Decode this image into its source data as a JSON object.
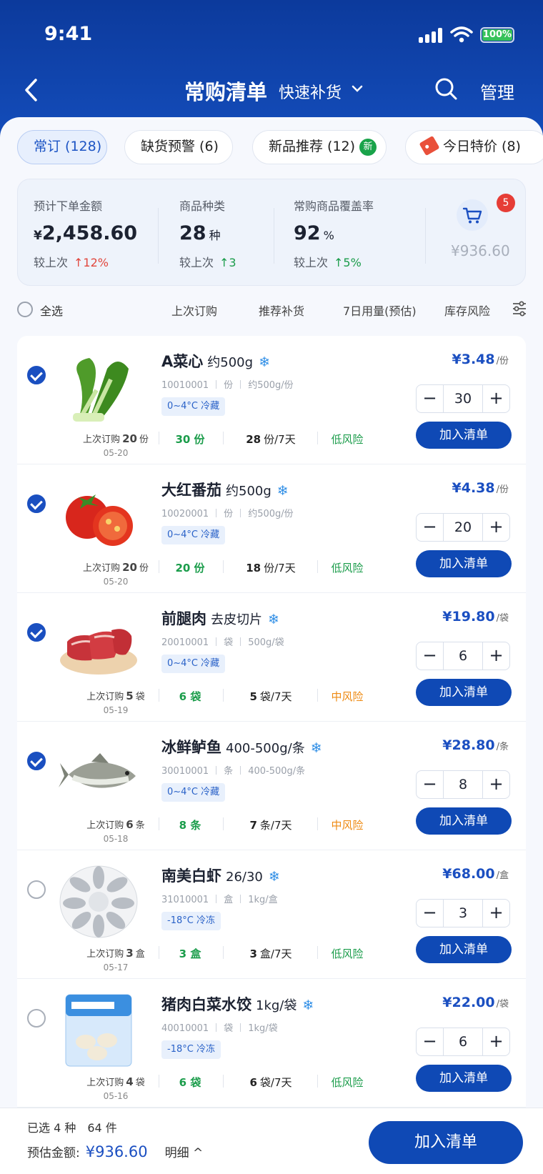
{
  "status_bar": {
    "time": "9:41",
    "battery": "100%"
  },
  "nav": {
    "title": "常购清单",
    "subtitle": "快速补货",
    "manage": "管理"
  },
  "tabs": [
    {
      "label": "常订 (128)"
    },
    {
      "label": "缺货预警 (6)"
    },
    {
      "label": "新品推荐 (12)",
      "badge": "新"
    },
    {
      "label": "今日特价 (8)"
    }
  ],
  "stats": {
    "amount": {
      "label": "预计下单金额",
      "currency": "¥",
      "value": "2,458.60",
      "compare_label": "较上次",
      "change": "↑12%"
    },
    "kinds": {
      "label": "商品种类",
      "value": "28",
      "unit": "种",
      "compare_label": "较上次",
      "change": "↑3"
    },
    "coverage": {
      "label": "常购商品覆盖率",
      "value": "92",
      "unit": "%",
      "compare_label": "较上次",
      "change": "↑5%"
    },
    "cart": {
      "badge": "5",
      "amount": "¥936.60"
    }
  },
  "filter_bar": {
    "select_all": "全选",
    "columns": [
      "上次订购",
      "推荐补货",
      "7日用量(预估)",
      "库存风险"
    ]
  },
  "items": [
    {
      "name": "A菜心",
      "spec": "约500g",
      "code": "10010001",
      "unit": "份",
      "pack": "约500g/份",
      "temp": "0~4°C 冷藏",
      "last_label": "上次订购",
      "last_qty": "20",
      "last_unit": "份",
      "last_date": "05-20",
      "rec": "30 份",
      "use_qty": "28",
      "use_unit": "份/7天",
      "risk": "低风险",
      "price": "¥3.48",
      "price_unit": "/份",
      "qty": "30",
      "add": "加入清单",
      "selected": true
    },
    {
      "name": "大红番茄",
      "spec": "约500g",
      "code": "10020001",
      "unit": "份",
      "pack": "约500g/份",
      "temp": "0~4°C 冷藏",
      "last_label": "上次订购",
      "last_qty": "20",
      "last_unit": "份",
      "last_date": "05-20",
      "rec": "20 份",
      "use_qty": "18",
      "use_unit": "份/7天",
      "risk": "低风险",
      "price": "¥4.38",
      "price_unit": "/份",
      "qty": "20",
      "add": "加入清单",
      "selected": true
    },
    {
      "name": "前腿肉",
      "spec": "去皮切片",
      "code": "20010001",
      "unit": "袋",
      "pack": "500g/袋",
      "temp": "0~4°C 冷藏",
      "last_label": "上次订购",
      "last_qty": "5",
      "last_unit": "袋",
      "last_date": "05-19",
      "rec": "6 袋",
      "use_qty": "5",
      "use_unit": "袋/7天",
      "risk": "中风险",
      "price": "¥19.80",
      "price_unit": "/袋",
      "qty": "6",
      "add": "加入清单",
      "selected": true
    },
    {
      "name": "冰鲜鲈鱼",
      "spec": "400-500g/条",
      "code": "30010001",
      "unit": "条",
      "pack": "400-500g/条",
      "temp": "0~4°C 冷藏",
      "last_label": "上次订购",
      "last_qty": "6",
      "last_unit": "条",
      "last_date": "05-18",
      "rec": "8 条",
      "use_qty": "7",
      "use_unit": "条/7天",
      "risk": "中风险",
      "price": "¥28.80",
      "price_unit": "/条",
      "qty": "8",
      "add": "加入清单",
      "selected": true
    },
    {
      "name": "南美白虾",
      "spec": "26/30",
      "code": "31010001",
      "unit": "盒",
      "pack": "1kg/盒",
      "temp": "-18°C 冷冻",
      "last_label": "上次订购",
      "last_qty": "3",
      "last_unit": "盒",
      "last_date": "05-17",
      "rec": "3 盒",
      "use_qty": "3",
      "use_unit": "盒/7天",
      "risk": "低风险",
      "price": "¥68.00",
      "price_unit": "/盒",
      "qty": "3",
      "add": "加入清单",
      "selected": false
    },
    {
      "name": "猪肉白菜水饺",
      "spec": "1kg/袋",
      "code": "40010001",
      "unit": "袋",
      "pack": "1kg/袋",
      "temp": "-18°C 冷冻",
      "last_label": "上次订购",
      "last_qty": "4",
      "last_unit": "袋",
      "last_date": "05-16",
      "rec": "6 袋",
      "use_qty": "6",
      "use_unit": "袋/7天",
      "risk": "低风险",
      "price": "¥22.00",
      "price_unit": "/袋",
      "qty": "6",
      "add": "加入清单",
      "selected": false
    }
  ],
  "footer": {
    "selected": "已选 4 种　64 件",
    "est_label": "预估金额:",
    "est_amount": "¥936.60",
    "detail": "明细 ^",
    "cta": "加入清单"
  },
  "colors": {
    "brand": "#0f49b5",
    "low_risk": "#1a9c4a",
    "mid_risk": "#ee8a12"
  }
}
